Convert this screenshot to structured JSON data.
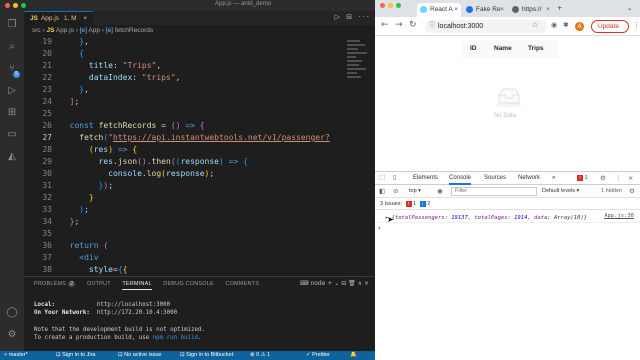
{
  "vscode": {
    "window_title": "App.js — antd_demo",
    "tab": {
      "label": "App.js",
      "suffix": "1, M",
      "close": "×"
    },
    "breadcrumb": {
      "folder": "src",
      "file_icon": "JS",
      "file": "App.js",
      "symbol_icon": "[e]",
      "symbol": "App",
      "symbol2_icon": "[e]",
      "symbol2": "fetchRecords"
    },
    "tab_actions": "▷ ⊟ ···",
    "line_numbers": [
      "19",
      "20",
      "21",
      "22",
      "23",
      "24",
      "25",
      "26",
      "27",
      "28",
      "29",
      "30",
      "31",
      "32",
      "33",
      "34",
      "35",
      "36",
      "37",
      "38"
    ],
    "current_line": "27",
    "activity_badge": "5",
    "panel": {
      "tabs": [
        "PROBLEMS",
        "OUTPUT",
        "TERMINAL",
        "DEBUG CONSOLE",
        "COMMENTS"
      ],
      "problems_count": "2",
      "active_tab": "TERMINAL",
      "shell": "node",
      "tools": "+ ⌄ ⊟ 🗑 ∧ ×",
      "terminal_lines": [
        {
          "label": "Local:",
          "value": "http://localhost:3000"
        },
        {
          "label": "On Your Network:",
          "value": "http://172.20.10.4:3000"
        }
      ],
      "note1": "Note that the development build is not optimized.",
      "note2_prefix": "To create a production build, use ",
      "note2_cmd": "npm run build",
      "note2_suffix": "."
    },
    "status": {
      "branch": "master*",
      "jira": "Sign in to Jira",
      "issue": "No active issue",
      "bitbucket": "Sign in to Bitbucket",
      "problems": "⊗ 0 ⚠ 1",
      "prettier": "✓ Prettier"
    }
  },
  "browser": {
    "tabs": [
      {
        "label": "React A",
        "fav_color": "#61dafb",
        "active": true
      },
      {
        "label": "Fake Re",
        "fav_color": "#1a73e8",
        "active": false
      },
      {
        "label": "https://",
        "fav_color": "#5f6368",
        "active": false
      }
    ],
    "new_tab": "+",
    "url": "localhost:3000",
    "update_label": "Update",
    "avatar_letter": "A",
    "table_headers": [
      "ID",
      "Name",
      "Trips"
    ],
    "empty_text": "No Data"
  },
  "devtools": {
    "tabs": [
      "Elements",
      "Console",
      "Sources",
      "Network",
      "»"
    ],
    "active_tab": "Console",
    "error_count": "1",
    "context": "top",
    "filter_placeholder": "Filter",
    "levels": "Default levels ▾",
    "hidden": "1 hidden",
    "issues_label": "3 Issues:",
    "issues_red": "1",
    "issues_blue": "2",
    "log": {
      "k1": "totalPassengers",
      "v1": "19137",
      "k2": "totalPages",
      "v2": "1914",
      "k3": "data",
      "v3": "Array(10)",
      "source": "App.js:30"
    }
  }
}
